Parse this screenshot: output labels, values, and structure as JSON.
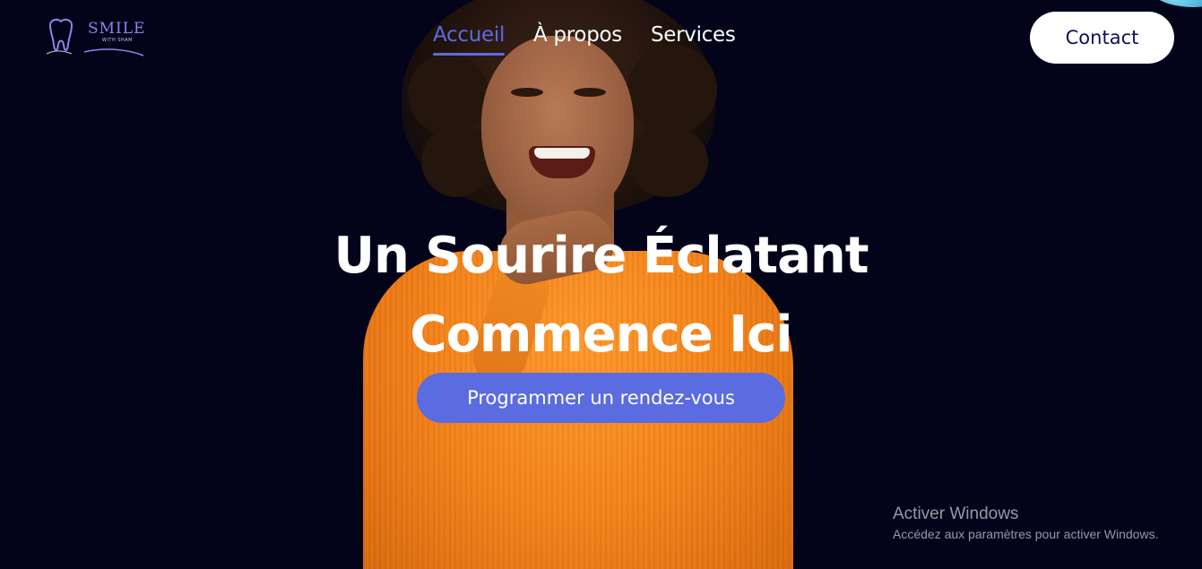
{
  "brand": {
    "logo_text": "SMILE",
    "logo_subtext": "WITH SHAM",
    "accent_color": "#5b6be0"
  },
  "nav": {
    "links": [
      {
        "label": "Accueil",
        "active": true
      },
      {
        "label": "À propos",
        "active": false
      },
      {
        "label": "Services",
        "active": false
      }
    ],
    "contact_label": "Contact"
  },
  "hero": {
    "title_line1": "Un Sourire Éclatant",
    "title_line2": "Commence Ici",
    "cta_label": "Programmer un rendez-vous"
  },
  "watermark": {
    "title": "Activer Windows",
    "subtitle": "Accédez aux paramètres pour activer Windows."
  }
}
